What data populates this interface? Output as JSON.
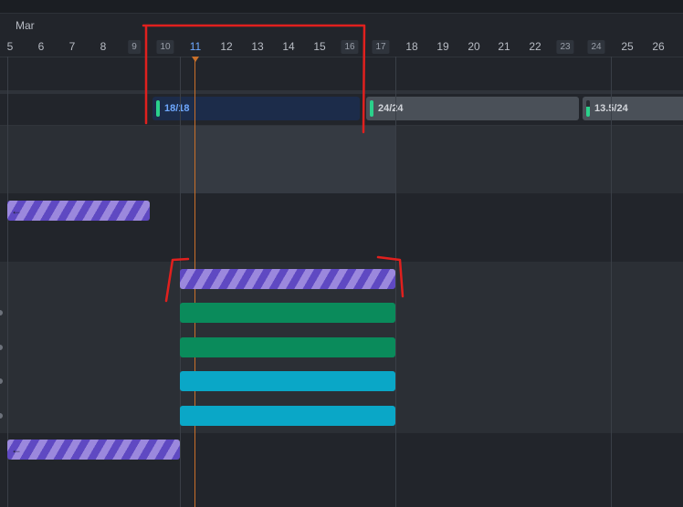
{
  "timeline": {
    "month": "Mar",
    "days": [
      {
        "label": "5",
        "weekend": false,
        "today": false
      },
      {
        "label": "6",
        "weekend": false,
        "today": false
      },
      {
        "label": "7",
        "weekend": false,
        "today": false
      },
      {
        "label": "8",
        "weekend": false,
        "today": false
      },
      {
        "label": "9",
        "weekend": true,
        "today": false
      },
      {
        "label": "10",
        "weekend": true,
        "today": false
      },
      {
        "label": "11",
        "weekend": false,
        "today": true
      },
      {
        "label": "12",
        "weekend": false,
        "today": false
      },
      {
        "label": "13",
        "weekend": false,
        "today": false
      },
      {
        "label": "14",
        "weekend": false,
        "today": false
      },
      {
        "label": "15",
        "weekend": false,
        "today": false
      },
      {
        "label": "16",
        "weekend": true,
        "today": false
      },
      {
        "label": "17",
        "weekend": true,
        "today": false
      },
      {
        "label": "18",
        "weekend": false,
        "today": false
      },
      {
        "label": "19",
        "weekend": false,
        "today": false
      },
      {
        "label": "20",
        "weekend": false,
        "today": false
      },
      {
        "label": "21",
        "weekend": false,
        "today": false
      },
      {
        "label": "22",
        "weekend": false,
        "today": false
      },
      {
        "label": "23",
        "weekend": true,
        "today": false
      },
      {
        "label": "24",
        "weekend": true,
        "today": false
      },
      {
        "label": "25",
        "weekend": false,
        "today": false
      },
      {
        "label": "26",
        "weekend": false,
        "today": false
      }
    ]
  },
  "sprints": [
    {
      "label": "18/18"
    },
    {
      "label": "24/24"
    },
    {
      "label": "13.5/24"
    }
  ],
  "tasks": [
    {
      "style": "striped",
      "arrow": "←"
    },
    {
      "style": "striped",
      "arrow": ""
    },
    {
      "style": "green",
      "arrow": ""
    },
    {
      "style": "green",
      "arrow": ""
    },
    {
      "style": "cyan",
      "arrow": ""
    },
    {
      "style": "cyan",
      "arrow": ""
    },
    {
      "style": "striped",
      "arrow": "←"
    }
  ],
  "colors": {
    "today_line": "#c9702a",
    "stripe_dark": "#5f49c2",
    "stripe_light": "#9b88dd",
    "green": "#0a8b5b",
    "cyan": "#0aa7c7",
    "sprint_indicator": "#2bd18b",
    "annotation": "#e0201e"
  }
}
